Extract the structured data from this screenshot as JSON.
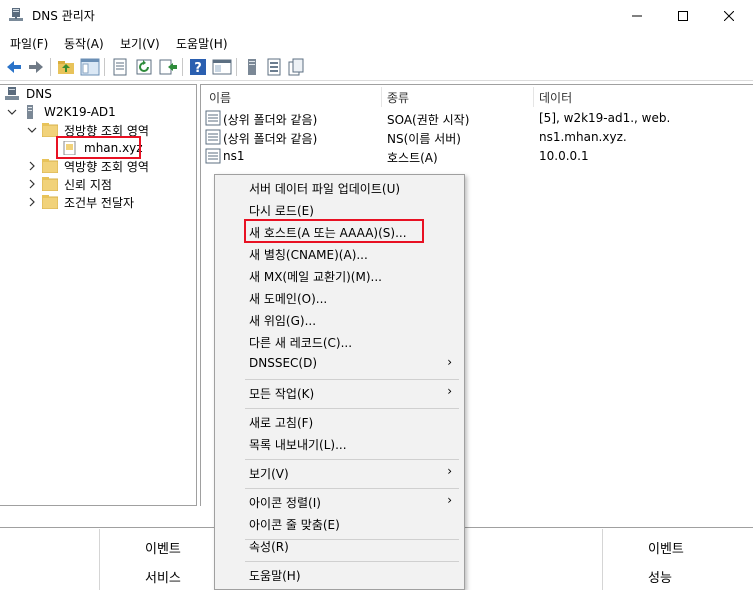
{
  "window": {
    "title": "DNS 관리자",
    "app_icon": "dns-manager-icon"
  },
  "menubar": [
    {
      "label": "파일(F)"
    },
    {
      "label": "동작(A)"
    },
    {
      "label": "보기(V)"
    },
    {
      "label": "도움말(H)"
    }
  ],
  "toolbar": {
    "icons": [
      "back-arrow-icon",
      "forward-arrow-icon",
      "up-folder-icon",
      "show-hide-tree-icon",
      "properties-sheet-icon",
      "refresh-icon",
      "export-list-icon",
      "help-icon",
      "console-tree-icon",
      "server-icon",
      "records-list-icon",
      "copy-record-icon"
    ]
  },
  "tree": {
    "root": "DNS",
    "server": "W2K19-AD1",
    "forward_zone": "정방향 조회 영역",
    "selected_zone": "mhan.xyz",
    "reverse_zone": "역방향 조회 영역",
    "trust_points": "신뢰 지점",
    "conditional_forwarders": "조건부 전달자"
  },
  "list": {
    "columns": [
      "이름",
      "종류",
      "데이터"
    ],
    "rows": [
      {
        "name": "(상위 폴더와 같음)",
        "type": "SOA(권한 시작)",
        "data": "[5], w2k19-ad1., web."
      },
      {
        "name": "(상위 폴더와 같음)",
        "type": "NS(이름 서버)",
        "data": "ns1.mhan.xyz."
      },
      {
        "name": "ns1",
        "type": "호스트(A)",
        "data": "10.0.0.1"
      }
    ]
  },
  "context_menu": {
    "groups": [
      [
        {
          "label": "서버 데이터 파일 업데이트(U)"
        },
        {
          "label": "다시 로드(E)"
        },
        {
          "label": "새 호스트(A 또는 AAAA)(S)...",
          "highlighted": true
        },
        {
          "label": "새 별칭(CNAME)(A)..."
        },
        {
          "label": "새 MX(메일 교환기)(M)..."
        },
        {
          "label": "새 도메인(O)..."
        },
        {
          "label": "새 위임(G)..."
        },
        {
          "label": "다른 새 레코드(C)..."
        },
        {
          "label": "DNSSEC(D)",
          "submenu": true
        }
      ],
      [
        {
          "label": "모든 작업(K)",
          "submenu": true
        }
      ],
      [
        {
          "label": "새로 고침(F)"
        },
        {
          "label": "목록 내보내기(L)..."
        }
      ],
      [
        {
          "label": "보기(V)",
          "submenu": true
        }
      ],
      [
        {
          "label": "아이콘 정렬(I)",
          "submenu": true
        },
        {
          "label": "아이콘 줄 맞춤(E)"
        }
      ],
      [
        {
          "label": "속성(R)"
        }
      ],
      [
        {
          "label": "도움말(H)"
        }
      ]
    ],
    "submenu_arrow": "›"
  },
  "bottom_panel": {
    "left_items": [
      "이벤트",
      "서비스"
    ],
    "right_items": [
      "이벤트",
      "성능"
    ]
  },
  "colors": {
    "highlight": "#e81123",
    "menu_bg": "#f2f2f2",
    "accent_blue": "#1e6fc9"
  }
}
